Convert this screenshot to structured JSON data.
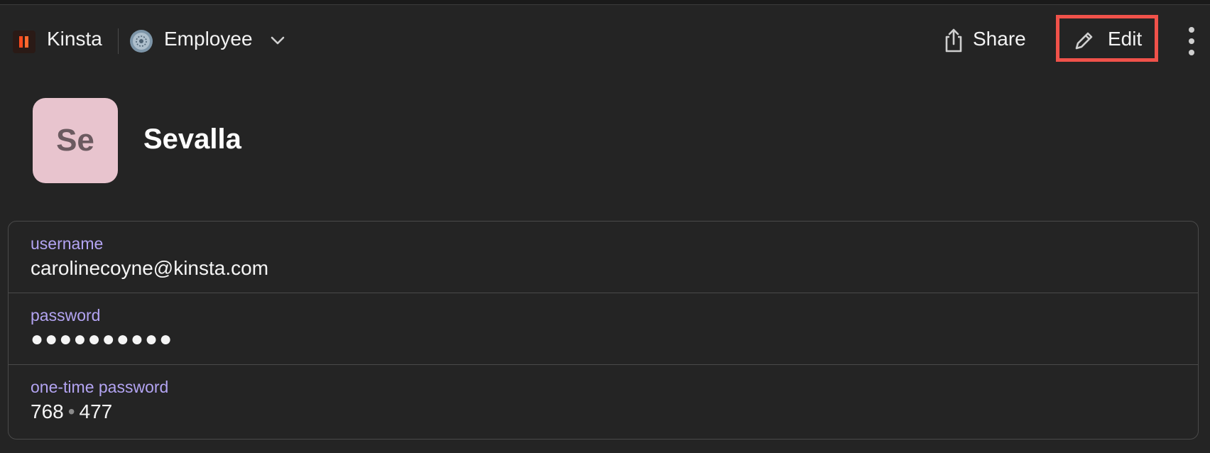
{
  "header": {
    "vault_name": "Kinsta",
    "collection_name": "Employee",
    "share_label": "Share",
    "edit_label": "Edit"
  },
  "item": {
    "avatar_initials": "Se",
    "title": "Sevalla",
    "avatar_color": "#e8c4ce"
  },
  "fields": [
    {
      "label": "username",
      "value": "carolinecoyne@kinsta.com"
    },
    {
      "label": "password",
      "value": "●●●●●●●●●●"
    },
    {
      "label": "one-time password",
      "value_part1": "768",
      "separator": "•",
      "value_part2": "477"
    }
  ],
  "colors": {
    "accent_label": "#b3a4f2",
    "highlight_border": "#f0524a",
    "background": "#242424"
  }
}
